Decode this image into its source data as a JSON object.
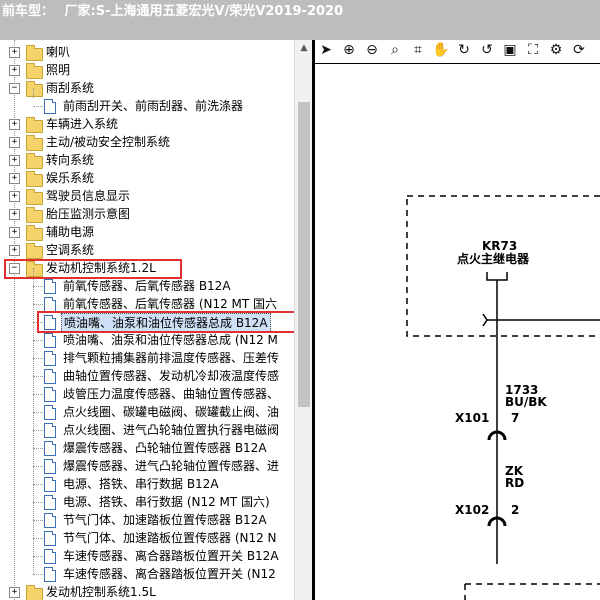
{
  "header": {
    "label": "前车型：",
    "value": "厂家:S-上海通用五菱宏光V/荣光V2019-2020"
  },
  "tree": {
    "folders": [
      {
        "label": "喇叭",
        "expander": "+"
      },
      {
        "label": "照明",
        "expander": "+"
      },
      {
        "label": "雨刮系统",
        "expander": "−"
      },
      {
        "label": "车辆进入系统",
        "expander": "+"
      },
      {
        "label": "主动/被动安全控制系统",
        "expander": "+"
      },
      {
        "label": "转向系统",
        "expander": "+"
      },
      {
        "label": "娱乐系统",
        "expander": "+"
      },
      {
        "label": "驾驶员信息显示",
        "expander": "+"
      },
      {
        "label": "胎压监测示意图",
        "expander": "+"
      },
      {
        "label": "辅助电源",
        "expander": "+"
      },
      {
        "label": "空调系统",
        "expander": "+"
      },
      {
        "label": "发动机控制系统1.2L",
        "expander": "−"
      },
      {
        "label": "发动机控制系统1.5L",
        "expander": "+"
      }
    ],
    "wiper_children": [
      "前雨刮开关、前雨刮器、前洗涤器"
    ],
    "engine_children": [
      "前氧传感器、后氧传感器 B12A",
      "前氧传感器、后氧传感器 (N12 MT 国六",
      "喷油嘴、油泵和油位传感器总成 B12A",
      "喷油嘴、油泵和油位传感器总成 (N12 M",
      "排气颗粒捕集器前排温度传感器、压差传",
      "曲轴位置传感器、发动机冷却液温度传感",
      "歧管压力温度传感器、曲轴位置传感器、",
      "点火线圈、碳罐电磁阀、碳罐截止阀、油",
      "点火线圈、进气凸轮轴位置执行器电磁阀",
      "爆震传感器、凸轮轴位置传感器 B12A",
      "爆震传感器、进气凸轮轴位置传感器、进",
      "电源、搭铁、串行数据 B12A",
      "电源、搭铁、串行数据 (N12 MT 国六)",
      "节气门体、加速踏板位置传感器 B12A",
      "节气门体、加速踏板位置传感器 (N12 N",
      "车速传感器、离合器踏板位置开关 B12A",
      "车速传感器、离合器踏板位置开关 (N12"
    ]
  },
  "toolbar": {
    "icons": [
      "pointer-icon",
      "zoom-in-icon",
      "zoom-out-icon",
      "zoom-window-icon",
      "crop-icon",
      "pan-hand-icon",
      "rotate-cw-icon",
      "rotate-ccw-icon",
      "fit-page-icon",
      "fullscreen-icon",
      "settings-icon",
      "refresh-icon"
    ],
    "glyphs": [
      "➤",
      "⊕",
      "⊖",
      "⌕",
      "⌗",
      "✋",
      "↻",
      "↺",
      "▣",
      "⛶",
      "⚙",
      "⟳"
    ]
  },
  "diagram": {
    "relay_code": "KR73",
    "relay_name": "点火主继电器",
    "wire1_code": "1733",
    "wire1_color": "BU/BK",
    "connector1": "X101",
    "connector1_pin": "7",
    "wire2_color1": "ZK",
    "wire2_color2": "RD",
    "connector2": "X102",
    "connector2_pin": "2"
  }
}
